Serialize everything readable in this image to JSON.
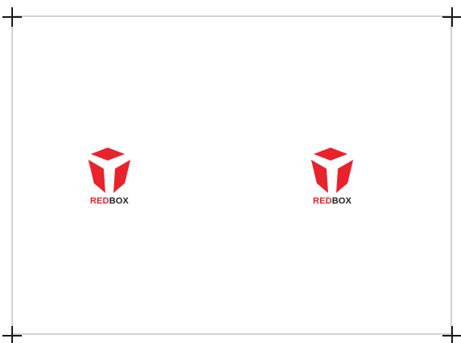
{
  "colors": {
    "brand_red": "#e8232b",
    "brand_dark": "#222222",
    "frame_border": "#d3d3d3",
    "crop_mark": "#1a1a1a",
    "background": "#ffffff"
  },
  "logos": [
    {
      "wordmark_part1": "RED",
      "wordmark_part2": "BOX",
      "icon": "red-cube-icon"
    },
    {
      "wordmark_part1": "RED",
      "wordmark_part2": "BOX",
      "icon": "red-cube-icon"
    }
  ]
}
